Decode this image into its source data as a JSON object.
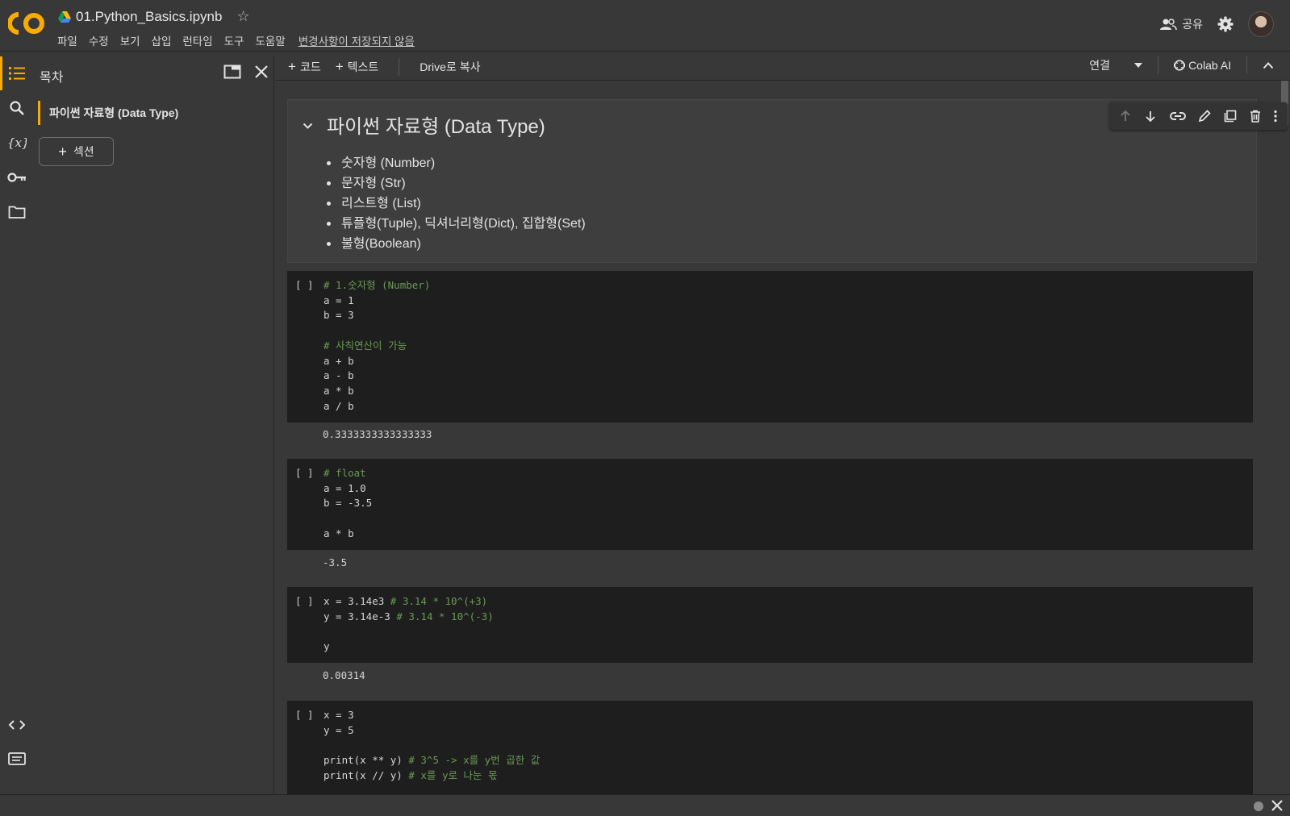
{
  "header": {
    "notebook_title": "01.Python_Basics.ipynb",
    "menu": [
      "파일",
      "수정",
      "보기",
      "삽입",
      "런타임",
      "도구",
      "도움말"
    ],
    "unsaved": "변경사항이 저장되지 않음",
    "share_label": "공유"
  },
  "toc": {
    "title": "목차",
    "items": [
      {
        "label": "파이썬 자료형 (Data Type)"
      }
    ],
    "section_button": "섹션"
  },
  "toolbar": {
    "add_code": "코드",
    "add_text": "텍스트",
    "copy_to_drive": "Drive로 복사",
    "connect": "연결",
    "colab_ai": "Colab AI"
  },
  "text_cell": {
    "heading": "파이썬 자료형 (Data Type)",
    "bullets": [
      "숫자형 (Number)",
      "문자형 (Str)",
      "리스트형 (List)",
      "튜플형(Tuple), 딕셔너리형(Dict), 집합형(Set)",
      "불형(Boolean)"
    ]
  },
  "cells": [
    {
      "run": "[ ]",
      "lines": [
        {
          "code": "",
          "comment": "# 1.숫자형 (Number)"
        },
        {
          "code": "a = 1",
          "comment": ""
        },
        {
          "code": "b = 3",
          "comment": ""
        },
        {
          "code": "",
          "comment": ""
        },
        {
          "code": "",
          "comment": "# 사칙연산이 가능"
        },
        {
          "code": "a + b",
          "comment": ""
        },
        {
          "code": "a - b",
          "comment": ""
        },
        {
          "code": "a * b",
          "comment": ""
        },
        {
          "code": "a / b",
          "comment": ""
        }
      ],
      "output": "0.3333333333333333"
    },
    {
      "run": "[ ]",
      "lines": [
        {
          "code": "",
          "comment": "# float"
        },
        {
          "code": "a = 1.0",
          "comment": ""
        },
        {
          "code": "b = -3.5",
          "comment": ""
        },
        {
          "code": "",
          "comment": ""
        },
        {
          "code": "a * b",
          "comment": ""
        }
      ],
      "output": "-3.5"
    },
    {
      "run": "[ ]",
      "lines": [
        {
          "code": "x = 3.14e3 ",
          "comment": "# 3.14 * 10^(+3)"
        },
        {
          "code": "y = 3.14e-3 ",
          "comment": "# 3.14 * 10^(-3)"
        },
        {
          "code": "",
          "comment": ""
        },
        {
          "code": "y",
          "comment": ""
        }
      ],
      "output": "0.00314"
    },
    {
      "run": "[ ]",
      "lines": [
        {
          "code": "x = 3",
          "comment": ""
        },
        {
          "code": "y = 5",
          "comment": ""
        },
        {
          "code": "",
          "comment": ""
        },
        {
          "code": "print(x ** y) ",
          "comment": "# 3^5 -> x를 y번 곱한 값"
        },
        {
          "code": "print(x // y) ",
          "comment": "# x를 y로 나눈 몫"
        }
      ],
      "output": ""
    }
  ],
  "colors": {
    "accent": "#f9ab00",
    "comment": "#6a9955",
    "code_bg": "#1e1e1e",
    "bg": "#383838"
  }
}
